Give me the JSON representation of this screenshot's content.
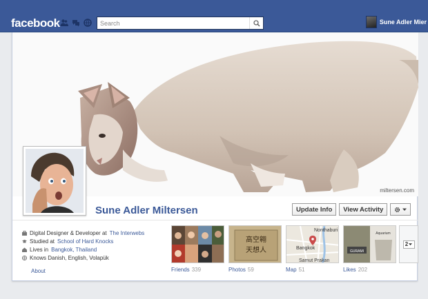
{
  "topbar": {
    "logo": "facebook",
    "search_placeholder": "Search",
    "user_name": "Sune Adler Mier",
    "jewels": [
      "friend-requests-icon",
      "messages-icon",
      "notifications-icon"
    ]
  },
  "cover": {
    "credit": "miltersen.com"
  },
  "profile": {
    "name": "Sune Adler Miltersen"
  },
  "actions": {
    "update_info": "Update Info",
    "view_activity": "View Activity"
  },
  "bio": {
    "work_prefix": "Digital Designer & Developer at",
    "work_link": "The Interwebs",
    "study_prefix": "Studied at",
    "study_link": "School of Hard Knocks",
    "lives_prefix": "Lives in",
    "lives_link": "Bangkok, Thailand",
    "languages": "Knows Danish, English, Volapük"
  },
  "about_label": "About",
  "apps": [
    {
      "label": "Friends",
      "count": "339"
    },
    {
      "label": "Photos",
      "count": "59"
    },
    {
      "label": "Map",
      "count": "51"
    },
    {
      "label": "Likes",
      "count": "202"
    }
  ],
  "map_labels": {
    "top": "Nonthaburi",
    "middle": "Bangkok",
    "bottom": "Samut Prakan"
  },
  "photo_sign_top": "高空翱",
  "photo_sign_bottom": "天想人",
  "likes_tag": "GURAMI",
  "likes_sign": "Aquarium",
  "more_count": "2",
  "colors": {
    "brand": "#3b5998",
    "link": "#3b5998"
  }
}
